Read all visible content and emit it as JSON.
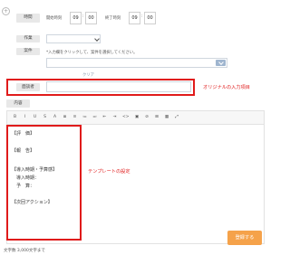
{
  "colors": {
    "accent_orange": "#f5a24a",
    "highlight_red": "#e01b1b",
    "label_gray": "#e8e8e8"
  },
  "time": {
    "label": "時間",
    "start_label": "開始時刻",
    "start_hour": "09",
    "start_minute": "00",
    "end_label": "終了時刻",
    "end_hour": "09",
    "end_minute": "00",
    "separator": ":"
  },
  "work": {
    "label": "作業",
    "value": ""
  },
  "case": {
    "label": "案件",
    "hint": "*入力欄をクリックして、案件を選択してください。"
  },
  "clear_link": "クリア",
  "interviewer": {
    "label": "面談者",
    "value": "",
    "annotation": "オリジナルの入力項目"
  },
  "content": {
    "label": "内容",
    "toolbar": [
      "B",
      "I",
      "U",
      "S",
      "A",
      "≣",
      "≡",
      "≔",
      "≕",
      "⇤",
      "⇥",
      "<>",
      "▣",
      "⊘",
      "⊞",
      "▦",
      "⤢"
    ],
    "template_lines": [
      "【評　価】",
      "",
      "【報　告】",
      "",
      "【導入時期・予算感】",
      "　導入時期：",
      "　予　算：",
      "",
      "【次回アクション】"
    ],
    "annotation": "テンプレートの設定"
  },
  "char_limit": "文字数 3,000文字まで",
  "submit_label": "登録する"
}
